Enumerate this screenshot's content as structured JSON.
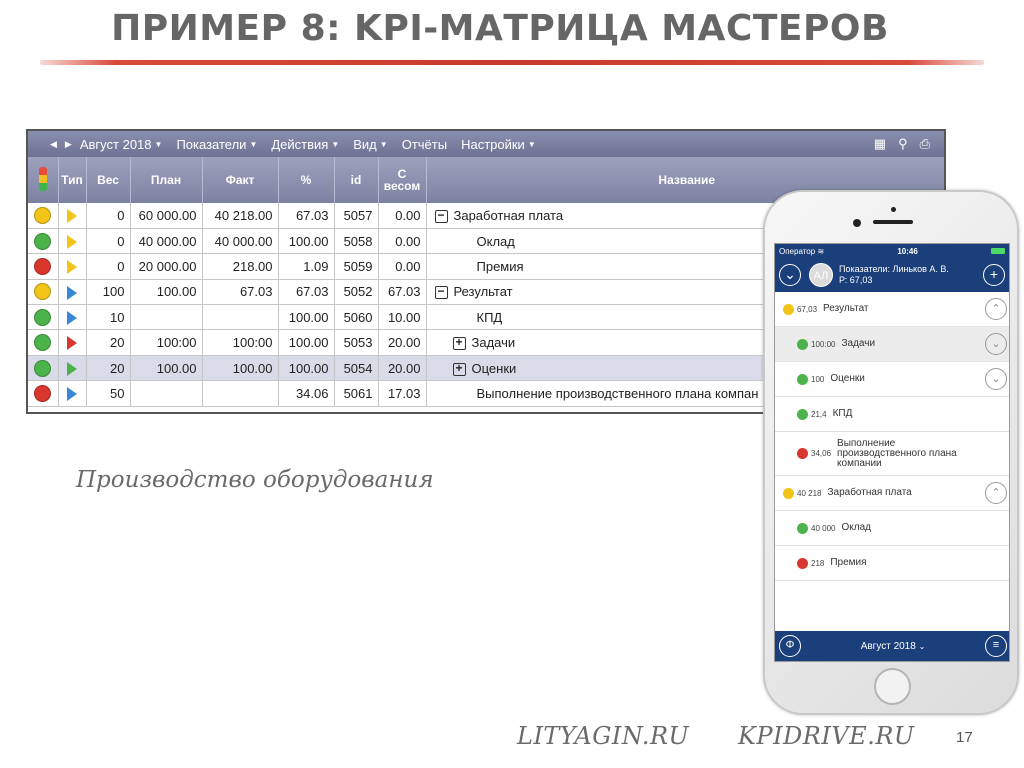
{
  "slide": {
    "title": "ПРИМЕР 8: KPI-МАТРИЦА МАСТЕРОВ",
    "caption": "Производство оборудования",
    "footer_left": "LITYAGIN.RU",
    "footer_right": "KPIDRIVE.RU",
    "page_number": "17",
    "accent_color": "#c9392b"
  },
  "desktop": {
    "toolbar": {
      "period": "Август 2018",
      "menus": [
        "Показатели",
        "Действия",
        "Вид",
        "Отчёты",
        "Настройки"
      ],
      "icons": [
        "grid-icon",
        "search-icon",
        "print-icon"
      ]
    },
    "columns": {
      "type": "Тип",
      "weight": "Вес",
      "plan": "План",
      "fact": "Факт",
      "percent": "%",
      "id": "id",
      "weighted": "С весом",
      "name": "Название"
    },
    "rows": [
      {
        "status": "yellow",
        "type": "yellow",
        "weight": "0",
        "plan": "60 000.00",
        "fact": "40 218.00",
        "percent": "67.03",
        "id": "5057",
        "weighted": "0.00",
        "name": "Заработная плата",
        "toggle": "−",
        "indent": 0
      },
      {
        "status": "green",
        "type": "yellow",
        "weight": "0",
        "plan": "40 000.00",
        "fact": "40 000.00",
        "percent": "100.00",
        "id": "5058",
        "weighted": "0.00",
        "name": "Оклад",
        "toggle": "",
        "indent": 2
      },
      {
        "status": "red",
        "type": "yellow",
        "weight": "0",
        "plan": "20 000.00",
        "fact": "218.00",
        "percent": "1.09",
        "id": "5059",
        "weighted": "0.00",
        "name": "Премия",
        "toggle": "",
        "indent": 2
      },
      {
        "status": "yellow",
        "type": "blue",
        "weight": "100",
        "plan": "100.00",
        "fact": "67.03",
        "percent": "67.03",
        "id": "5052",
        "weighted": "67.03",
        "name": "Результат",
        "toggle": "−",
        "indent": 0
      },
      {
        "status": "green",
        "type": "blue",
        "weight": "10",
        "plan": "",
        "fact": "",
        "percent": "100.00",
        "id": "5060",
        "weighted": "10.00",
        "name": "КПД",
        "toggle": "",
        "indent": 2
      },
      {
        "status": "green",
        "type": "red",
        "weight": "20",
        "plan": "100:00",
        "fact": "100:00",
        "percent": "100.00",
        "id": "5053",
        "weighted": "20.00",
        "name": "Задачи",
        "toggle": "+",
        "indent": 1
      },
      {
        "status": "green",
        "type": "green",
        "weight": "20",
        "plan": "100.00",
        "fact": "100.00",
        "percent": "100.00",
        "id": "5054",
        "weighted": "20.00",
        "name": "Оценки",
        "toggle": "+",
        "indent": 1,
        "highlight": true
      },
      {
        "status": "red",
        "type": "blue",
        "weight": "50",
        "plan": "",
        "fact": "",
        "percent": "34.06",
        "id": "5061",
        "weighted": "17.03",
        "name": "Выполнение производственного плана компан",
        "toggle": "",
        "indent": 2
      }
    ]
  },
  "mobile": {
    "carrier": "Оператор",
    "time": "10:46",
    "avatar_initials": "АЛ",
    "header_line1": "Показатели: Линьков А. В.",
    "header_line2": "Р: 67,03",
    "items": [
      {
        "status": "yellow",
        "value": "67,03",
        "label": "Результат",
        "indent": 0,
        "toggle": "up",
        "shaded": false
      },
      {
        "status": "green",
        "value": "100:00",
        "label": "Задачи",
        "indent": 1,
        "toggle": "down",
        "shaded": true
      },
      {
        "status": "green",
        "value": "100",
        "label": "Оценки",
        "indent": 1,
        "toggle": "down",
        "shaded": false
      },
      {
        "status": "green",
        "value": "21,4",
        "label": "КПД",
        "indent": 1,
        "toggle": "",
        "shaded": false
      },
      {
        "status": "red",
        "value": "34,06",
        "label": "Выполнение производственного плана компании",
        "indent": 1,
        "toggle": "",
        "shaded": false
      },
      {
        "status": "yellow",
        "value": "40 218",
        "label": "Заработная плата",
        "indent": 0,
        "toggle": "up",
        "shaded": false
      },
      {
        "status": "green",
        "value": "40 000",
        "label": "Оклад",
        "indent": 1,
        "toggle": "",
        "shaded": false
      },
      {
        "status": "red",
        "value": "218",
        "label": "Премия",
        "indent": 1,
        "toggle": "",
        "shaded": false
      }
    ],
    "bottom_period": "Август 2018"
  },
  "colors": {
    "yellow": "#f2c418",
    "green": "#4cb34a",
    "red": "#d9372e",
    "blue": "#3a86d6",
    "nav_blue": "#1b3f7a"
  }
}
